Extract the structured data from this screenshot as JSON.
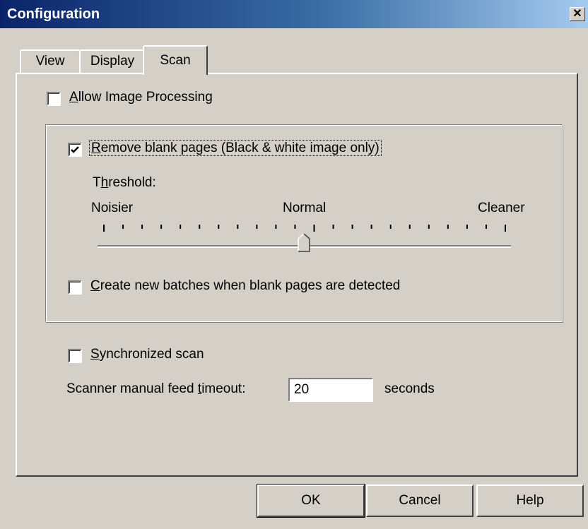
{
  "window": {
    "title": "Configuration",
    "close_glyph": "✕"
  },
  "tabs": [
    {
      "label": "View",
      "selected": false
    },
    {
      "label": "Display",
      "selected": false
    },
    {
      "label": "Scan",
      "selected": true
    }
  ],
  "scan": {
    "allow_processing": {
      "mnemonic": "A",
      "rest": "llow Image Processing",
      "checked": false
    },
    "remove_blank": {
      "mnemonic": "R",
      "rest": "emove blank pages (Black & white image only)",
      "checked": true
    },
    "threshold": {
      "label_pre": "T",
      "mnemonic": "h",
      "label_post": "reshold:",
      "min_label": "Noisier",
      "mid_label": "Normal",
      "max_label": "Cleaner",
      "tick_count": 22,
      "value_fraction": 0.5
    },
    "create_batches": {
      "mnemonic": "C",
      "rest": "reate new batches when blank pages are detected",
      "checked": false
    },
    "synchronized": {
      "mnemonic": "S",
      "rest": "ynchronized scan",
      "checked": false
    },
    "timeout": {
      "label_pre": "Scanner manual feed ",
      "mnemonic": "t",
      "label_post": "imeout:",
      "value": "20",
      "unit": "seconds"
    }
  },
  "buttons": {
    "ok": "OK",
    "cancel": "Cancel",
    "help": "Help"
  }
}
